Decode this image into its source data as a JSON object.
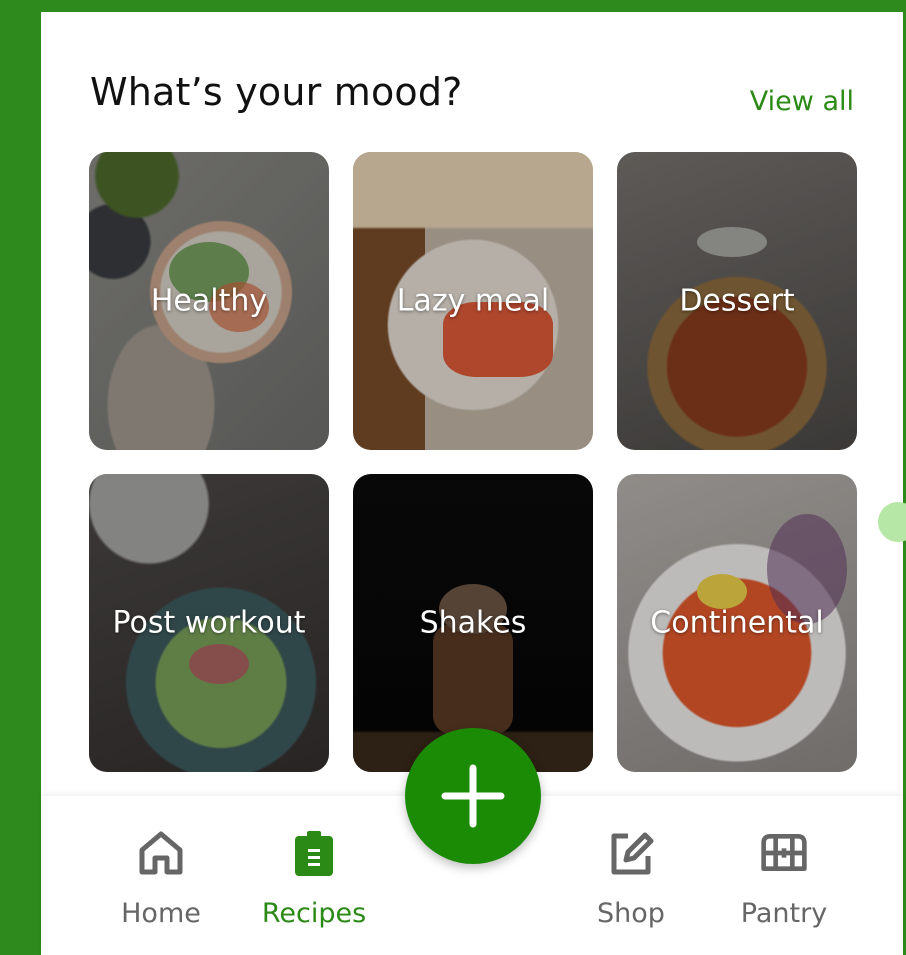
{
  "header": {
    "title": "What’s your mood?",
    "view_all": "View all"
  },
  "moods": [
    {
      "label": "Healthy",
      "image": "healthy-bowl-image"
    },
    {
      "label": "Lazy meal",
      "image": "toast-plate-image"
    },
    {
      "label": "Dessert",
      "image": "halwa-dessert-image"
    },
    {
      "label": "Post workout",
      "image": "salad-bowl-image"
    },
    {
      "label": "Shakes",
      "image": "chocolate-shake-image"
    },
    {
      "label": "Continental",
      "image": "spaghetti-image"
    }
  ],
  "nav": {
    "home": "Home",
    "recipes": "Recipes",
    "shop": "Shop",
    "pantry": "Pantry",
    "active": "Recipes"
  },
  "colors": {
    "accent": "#2b8a16",
    "fab": "#1b8b06",
    "inactive": "#666666"
  }
}
